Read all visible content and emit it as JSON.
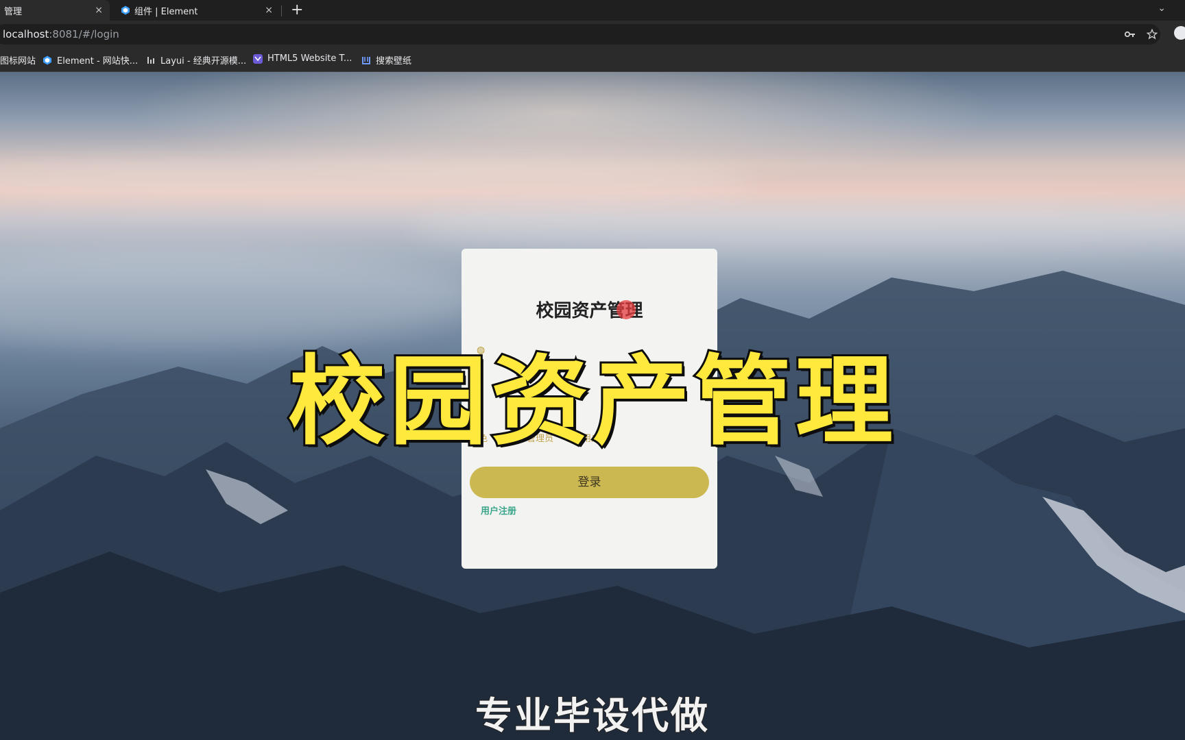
{
  "browser": {
    "tabs": [
      {
        "title": "管理",
        "active": true
      },
      {
        "title": "组件 | Element",
        "active": false
      }
    ],
    "close_glyph": "×",
    "new_tab_glyph": "+",
    "tab_menu_glyph": "⌄",
    "url_host": "localhost",
    "url_path": ":8081/#/login",
    "bookmarks": [
      {
        "label": "图标网站",
        "icon": "bookmark-icon"
      },
      {
        "label": "Element - 网站快...",
        "icon": "element-icon"
      },
      {
        "label": "Layui - 经典开源模...",
        "icon": "layui-icon"
      },
      {
        "label": "HTML5 Website T...",
        "icon": "html5-icon"
      },
      {
        "label": "搜索壁纸",
        "icon": "wallpaper-icon"
      }
    ],
    "accent_colors": {
      "element": "#409eff",
      "html5": "#6b5bd6",
      "wallpaper": "#4a7bd0"
    }
  },
  "login": {
    "title": "校园资产管理",
    "role_label": "角色",
    "role_options": [
      "管理员",
      "用户"
    ],
    "login_button": "登录",
    "register_link": "用户注册",
    "colors": {
      "button": "#ccb851",
      "link": "#3aa58a",
      "label": "#c2a04a"
    }
  },
  "overlay": {
    "headline": "校园资产管理",
    "subtitle": "专业毕设代做",
    "headline_color": "#ffe93d"
  }
}
